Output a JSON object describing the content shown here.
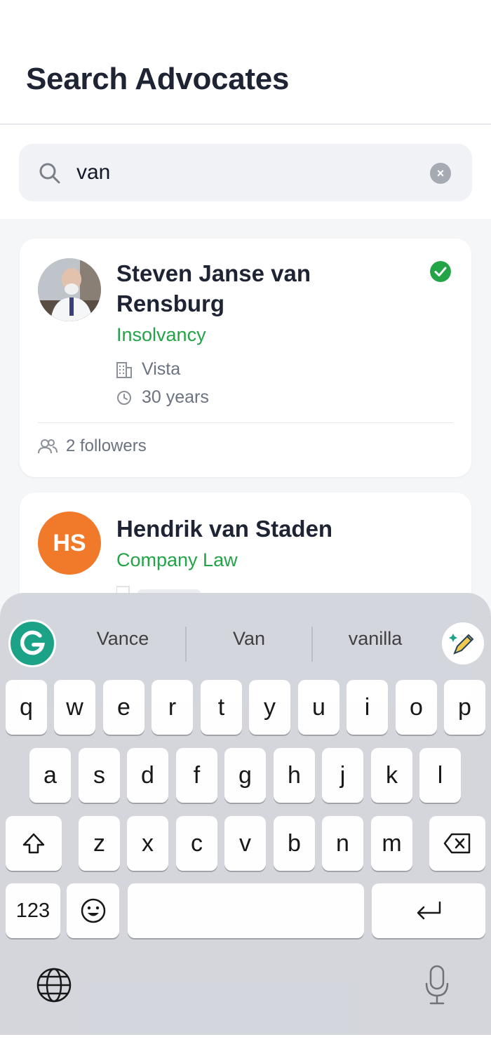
{
  "header": {
    "title": "Search Advocates"
  },
  "search": {
    "value": "van",
    "clear_glyph": "×",
    "icon": "search-icon"
  },
  "results": [
    {
      "name": "Steven Janse van Rensburg",
      "specialty": "Insolvancy",
      "location": "Vista",
      "experience": "30 years",
      "followers": "2 followers",
      "verified": true,
      "avatar": "photo"
    },
    {
      "name": "Hendrik van Staden",
      "specialty": "Company Law",
      "initials": "HS",
      "avatar_color": "#f1792a"
    }
  ],
  "keyboard": {
    "suggestions": [
      "Vance",
      "Van",
      "vanilla"
    ],
    "row1": [
      "q",
      "w",
      "e",
      "r",
      "t",
      "y",
      "u",
      "i",
      "o",
      "p"
    ],
    "row2": [
      "a",
      "s",
      "d",
      "f",
      "g",
      "h",
      "j",
      "k",
      "l"
    ],
    "row3": [
      "z",
      "x",
      "c",
      "v",
      "b",
      "n",
      "m"
    ],
    "numbers_label": "123",
    "emoji_glyph": "☺",
    "return_glyph": "↵"
  },
  "colors": {
    "accent_green": "#22a447",
    "title": "#1e2433",
    "muted": "#6b7280"
  }
}
